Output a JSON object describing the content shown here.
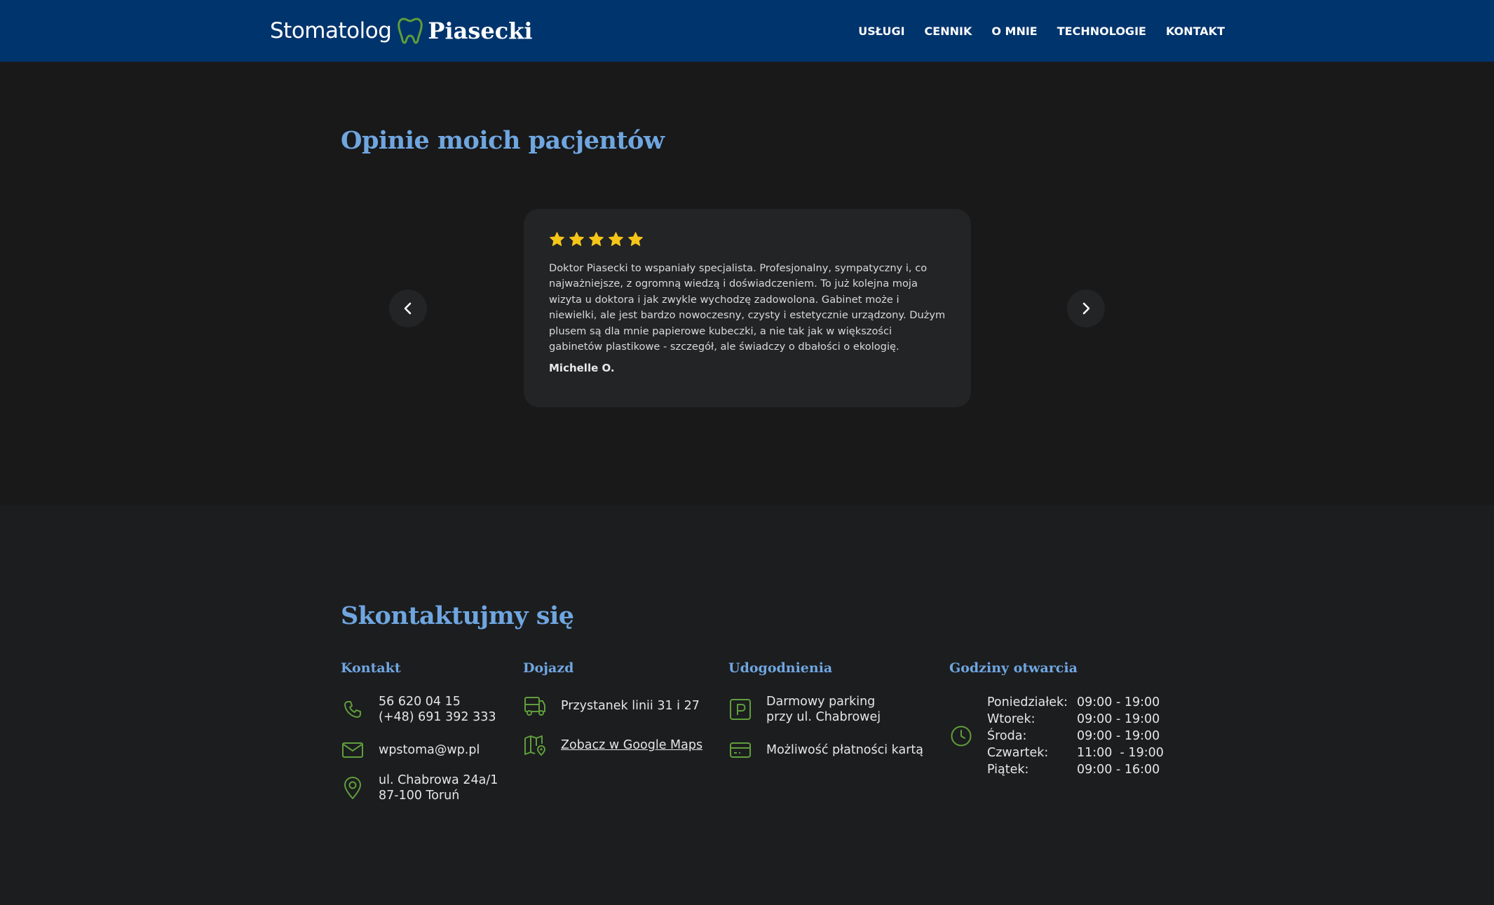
{
  "header": {
    "logo_light": "Stomatolog",
    "logo_bold": "Piasecki",
    "logo_icon": "tooth-icon",
    "menu": [
      {
        "label": "USŁUGI"
      },
      {
        "label": "CENNIK"
      },
      {
        "label": "O MNIE"
      },
      {
        "label": "TECHNOLOGIE"
      },
      {
        "label": "KONTAKT"
      }
    ]
  },
  "opinions": {
    "title": "Opinie moich pacjentów",
    "review": {
      "rating": 5,
      "rating_max": 5,
      "text": "Doktor Piasecki to wspaniały specjalista. Profesjonalny, sympatyczny i, co najważniejsze, z ogromną wiedzą i doświadczeniem. To już kolejna moja wizyta u doktora i jak zwykle wychodzę zadowolona. Gabinet może i niewielki, ale jest bardzo nowoczesny, czysty i estetycznie urządzony. Dużym plusem są dla mnie papierowe kubeczki, a nie tak jak w większości gabinetów plastikowe - szczegół, ale świadczy o dbałości o ekologię.",
      "author": "Michelle O."
    },
    "prev_icon": "chevron-left-icon",
    "next_icon": "chevron-right-icon"
  },
  "contact": {
    "title": "Skontaktujmy się",
    "kontakt": {
      "title": "Kontakt",
      "phone_1": "56 620 04 15",
      "phone_2": "(+48) 691 392 333",
      "email": "wpstoma@wp.pl",
      "address_1": "ul. Chabrowa 24a/1",
      "address_2": "87-100 Toruń"
    },
    "dojazd": {
      "title": "Dojazd",
      "bus": "Przystanek linii 31 i 27",
      "maps_link": "Zobacz w Google Maps"
    },
    "udogodnienia": {
      "title": "Udogodnienia",
      "parking_1": "Darmowy parking",
      "parking_2": "przy ul. Chabrowej",
      "card": "Możliwość płatności kartą"
    },
    "godziny": {
      "title": "Godziny otwarcia",
      "rows": [
        {
          "day": "Poniedziałek:",
          "hours": "09:00 - 19:00"
        },
        {
          "day": "Wtorek:",
          "hours": "09:00 - 19:00"
        },
        {
          "day": "Środa:",
          "hours": "09:00 - 19:00"
        },
        {
          "day": "Czwartek:",
          "hours": "11:00  - 19:00"
        },
        {
          "day": "Piątek:",
          "hours": "09:00 - 16:00"
        }
      ]
    }
  },
  "colors": {
    "nav_bg": "#00346d",
    "accent_blue": "#6fa6e0",
    "icon_green": "#5f9e3b",
    "star_yellow": "#f5c518"
  }
}
